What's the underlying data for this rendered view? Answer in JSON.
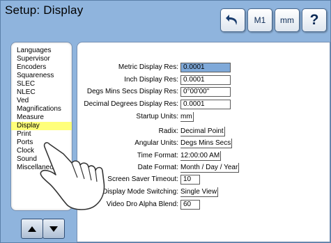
{
  "title": "Setup: Display",
  "toolbar": {
    "undo_icon": "undo-arrow-icon",
    "m1_label": "M1",
    "mm_label": "mm",
    "help_label": "?"
  },
  "sidebar": {
    "items": [
      {
        "label": "Languages"
      },
      {
        "label": "Supervisor"
      },
      {
        "label": "Encoders"
      },
      {
        "label": "Squareness"
      },
      {
        "label": "SLEC"
      },
      {
        "label": "NLEC"
      },
      {
        "label": "Ved"
      },
      {
        "label": "Magnifications"
      },
      {
        "label": "Measure"
      },
      {
        "label": "Display",
        "selected": true
      },
      {
        "label": "Print"
      },
      {
        "label": "Ports"
      },
      {
        "label": "Clock"
      },
      {
        "label": "Sound"
      },
      {
        "label": "Miscellaneous"
      }
    ]
  },
  "nav": {
    "up_icon": "triangle-up-icon",
    "down_icon": "triangle-down-icon"
  },
  "settings": {
    "metric_res": {
      "label": "Metric Display Res:",
      "value": "0.0001"
    },
    "inch_res": {
      "label": "Inch Display Res:",
      "value": "0.0001"
    },
    "dms_res": {
      "label": "Degs Mins Secs Display Res:",
      "value": "0°00'00\""
    },
    "dd_res": {
      "label": "Decimal Degrees Display Res:",
      "value": "0.0001"
    },
    "startup_units": {
      "label": "Startup Units:",
      "value": "mm"
    },
    "radix": {
      "label": "Radix:",
      "value": "Decimal Point"
    },
    "angular_units": {
      "label": "Angular Units:",
      "value": "Degs Mins Secs"
    },
    "time_format": {
      "label": "Time Format:",
      "value": "12:00:00 AM"
    },
    "date_format": {
      "label": "Date Format:",
      "value": "Month / Day / Year"
    },
    "screen_saver": {
      "label": "Screen Saver Timeout:",
      "value": "10"
    },
    "display_mode": {
      "label": "Display Mode Switching:",
      "value": "Single View"
    },
    "video_blend": {
      "label": "Video Dro Alpha Blend:",
      "value": "60"
    }
  },
  "colors": {
    "background": "#8fb4dd",
    "selected_item": "#ffff7a",
    "highlighted_field": "#7fa9d9"
  }
}
